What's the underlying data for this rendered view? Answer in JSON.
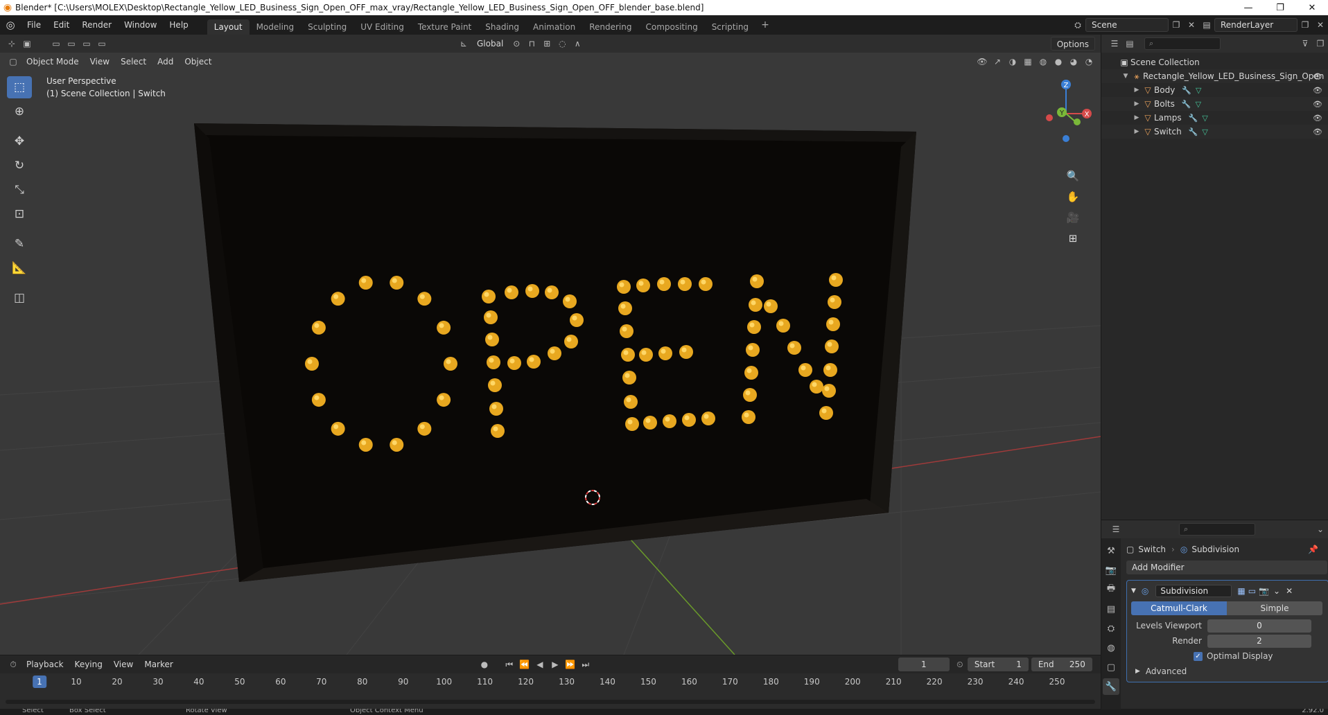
{
  "window": {
    "title": "Blender* [C:\\Users\\MOLEX\\Desktop\\Rectangle_Yellow_LED_Business_Sign_Open_OFF_max_vray/Rectangle_Yellow_LED_Business_Sign_Open_OFF_blender_base.blend]",
    "minimize": "—",
    "restore": "❐",
    "close": "✕"
  },
  "menu": [
    "File",
    "Edit",
    "Render",
    "Window",
    "Help"
  ],
  "workspaces": [
    {
      "label": "Layout",
      "active": true
    },
    {
      "label": "Modeling",
      "active": false
    },
    {
      "label": "Sculpting",
      "active": false
    },
    {
      "label": "UV Editing",
      "active": false
    },
    {
      "label": "Texture Paint",
      "active": false
    },
    {
      "label": "Shading",
      "active": false
    },
    {
      "label": "Animation",
      "active": false
    },
    {
      "label": "Rendering",
      "active": false
    },
    {
      "label": "Compositing",
      "active": false
    },
    {
      "label": "Scripting",
      "active": false
    }
  ],
  "scene": {
    "name": "Scene",
    "render_layer": "RenderLayer"
  },
  "viewport": {
    "mode": "Object Mode",
    "menus": [
      "View",
      "Select",
      "Add",
      "Object"
    ],
    "transform_orientation": "Global",
    "options_label": "Options",
    "info_line1": "User Perspective",
    "info_line2": "(1) Scene Collection | Switch",
    "sign_text": "OPEN",
    "colors": {
      "lamp": "#e8a820",
      "board": "#0a0806",
      "grid_bg": "#393939",
      "x_axis": "#a03a3a",
      "y_axis": "#6a9a2a"
    }
  },
  "gizmo": {
    "z": "Z",
    "y": "Y",
    "x": "X"
  },
  "outliner": {
    "root": "Scene Collection",
    "items": [
      {
        "name": "Rectangle_Yellow_LED_Business_Sign_Open",
        "level": 1
      },
      {
        "name": "Body",
        "level": 2
      },
      {
        "name": "Bolts",
        "level": 2
      },
      {
        "name": "Lamps",
        "level": 2
      },
      {
        "name": "Switch",
        "level": 2
      }
    ]
  },
  "properties": {
    "object_name": "Switch",
    "modifier_crumb": "Subdivision",
    "add_modifier": "Add Modifier",
    "modifier_name": "Subdivision",
    "algo_options": [
      "Catmull-Clark",
      "Simple"
    ],
    "levels_viewport_label": "Levels Viewport",
    "levels_viewport": "0",
    "render_label": "Render",
    "render_levels": "2",
    "optimal_display": "Optimal Display",
    "advanced": "Advanced"
  },
  "timeline": {
    "menus": [
      "Playback",
      "Keying",
      "View",
      "Marker"
    ],
    "current_frame": "1",
    "start_label": "Start",
    "start": "1",
    "end_label": "End",
    "end": "250",
    "ticks": [
      "1",
      "10",
      "20",
      "30",
      "40",
      "50",
      "60",
      "70",
      "80",
      "90",
      "100",
      "110",
      "120",
      "130",
      "140",
      "150",
      "160",
      "170",
      "180",
      "190",
      "200",
      "210",
      "220",
      "230",
      "240",
      "250"
    ]
  },
  "status": {
    "select": "Select",
    "box_select": "Box Select",
    "rotate": "Rotate View",
    "context": "Object Context Menu",
    "version": "2.92.0"
  }
}
